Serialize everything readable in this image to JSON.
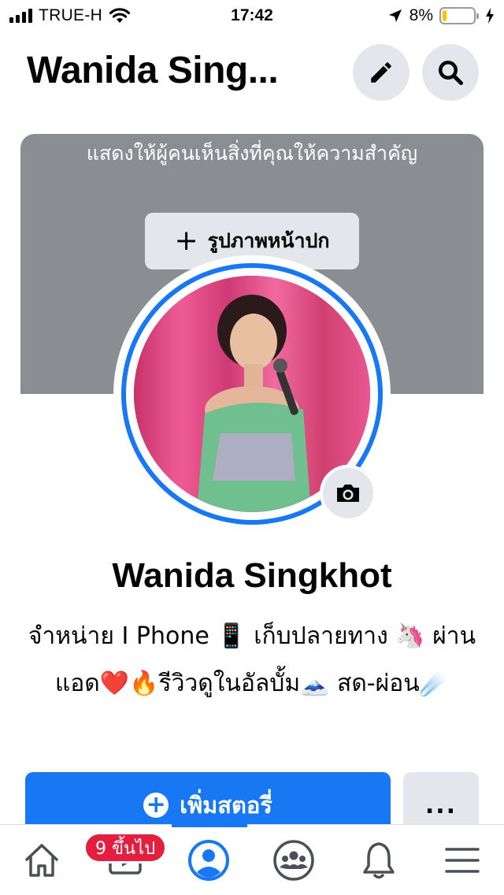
{
  "status_bar": {
    "carrier": "TRUE-H",
    "time": "17:42",
    "battery_percent": "8%",
    "battery_level": 0.08,
    "icons": [
      "signal-bars-icon",
      "wifi-icon",
      "location-arrow-icon",
      "battery-icon",
      "charging-bolt-icon"
    ]
  },
  "header": {
    "title": "Wanida Sing...",
    "edit_icon": "pencil-icon",
    "search_icon": "search-icon"
  },
  "cover": {
    "prompt": "แสดงให้ผู้คนเห็นสิ่งที่คุณให้ความสำคัญ",
    "button_label": "รูปภาพหน้าปก",
    "button_icon": "plus-icon"
  },
  "profile": {
    "name": "Wanida Singkhot",
    "bio": "จำหน่าย I Phone 📱 เก็บปลายทาง 🦄 ผ่านแอด❤️🔥รีวิวดูในอัลบั้ม🗻 สด-ผ่อน☄️",
    "camera_icon": "camera-icon"
  },
  "actions": {
    "add_story_label": "เพิ่มสตอรี่",
    "more_label": "..."
  },
  "tabbar": {
    "badge": "9 ขึ้นไป",
    "tabs": [
      "home-icon",
      "watch-icon",
      "profile-icon",
      "groups-icon",
      "notifications-icon",
      "menu-icon"
    ],
    "active_tab": "profile-icon"
  },
  "colors": {
    "accent": "#1877f2",
    "cover_gray": "#8a8d91",
    "button_gray": "#e4e6eb",
    "badge_red": "#e41e3f",
    "battery_yellow": "#f7c600"
  }
}
